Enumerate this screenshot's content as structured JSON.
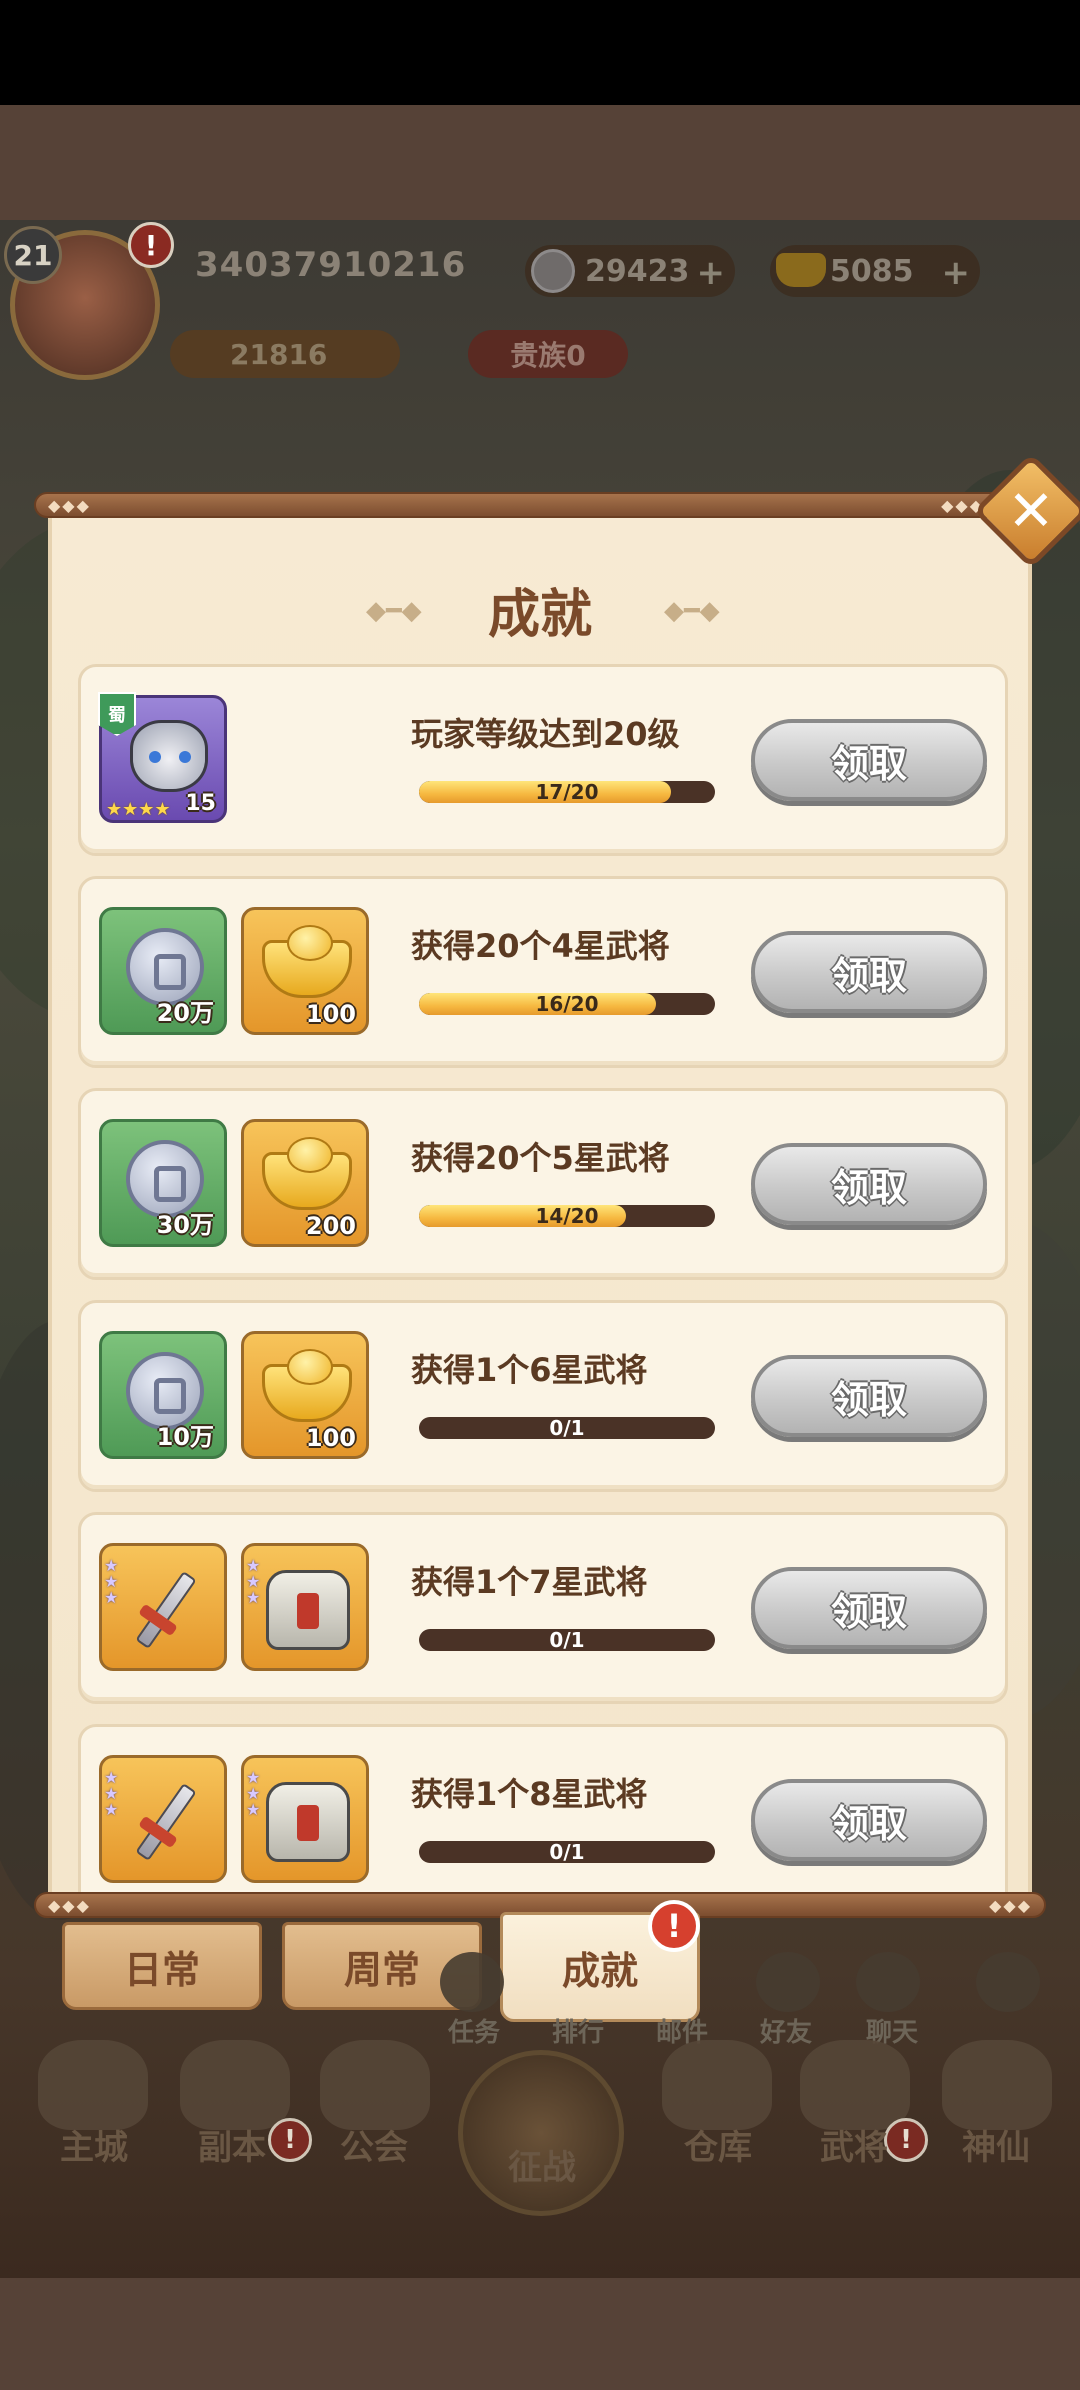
{
  "hud": {
    "level": "21",
    "player_id": "34037910216",
    "coins": "29423",
    "ingots": "5085",
    "paw_value": "21816",
    "noble": "贵族0",
    "alert": "!"
  },
  "dialog": {
    "title": "成就",
    "close_icon": "close-icon",
    "claim_label": "领取"
  },
  "achievements": [
    {
      "task": "玩家等级达到20级",
      "progress_text": "17/20",
      "progress": 0.85,
      "rewards": [
        {
          "type": "hero",
          "faction": "蜀",
          "level": "15",
          "stars": 4
        }
      ]
    },
    {
      "task": "获得20个4星武将",
      "progress_text": "16/20",
      "progress": 0.8,
      "rewards": [
        {
          "type": "coin",
          "qty": "20万"
        },
        {
          "type": "ingot",
          "qty": "100"
        }
      ]
    },
    {
      "task": "获得20个5星武将",
      "progress_text": "14/20",
      "progress": 0.7,
      "rewards": [
        {
          "type": "coin",
          "qty": "30万"
        },
        {
          "type": "ingot",
          "qty": "200"
        }
      ]
    },
    {
      "task": "获得1个6星武将",
      "progress_text": "0/1",
      "progress": 0,
      "rewards": [
        {
          "type": "coin",
          "qty": "10万"
        },
        {
          "type": "ingot",
          "qty": "100"
        }
      ]
    },
    {
      "task": "获得1个7星武将",
      "progress_text": "0/1",
      "progress": 0,
      "rewards": [
        {
          "type": "weapon"
        },
        {
          "type": "armor"
        }
      ]
    },
    {
      "task": "获得1个8星武将",
      "progress_text": "0/1",
      "progress": 0,
      "rewards": [
        {
          "type": "weapon"
        },
        {
          "type": "armor"
        }
      ]
    }
  ],
  "tabs": [
    {
      "label": "日常",
      "active": false
    },
    {
      "label": "周常",
      "active": false
    },
    {
      "label": "成就",
      "active": true
    }
  ],
  "subnav": [
    "任务",
    "排行",
    "邮件",
    "好友",
    "聊天"
  ],
  "nav": [
    "主城",
    "副本",
    "公会",
    "征战",
    "仓库",
    "武将",
    "神仙"
  ],
  "colors": {
    "panel": "#f7ead3",
    "title": "#7a4a2a",
    "text": "#5b3a22",
    "progress_fill": "#f6b840",
    "progress_track": "#4a3226",
    "claim_button": "#c9c9c9",
    "alert_red": "#d6402e"
  }
}
